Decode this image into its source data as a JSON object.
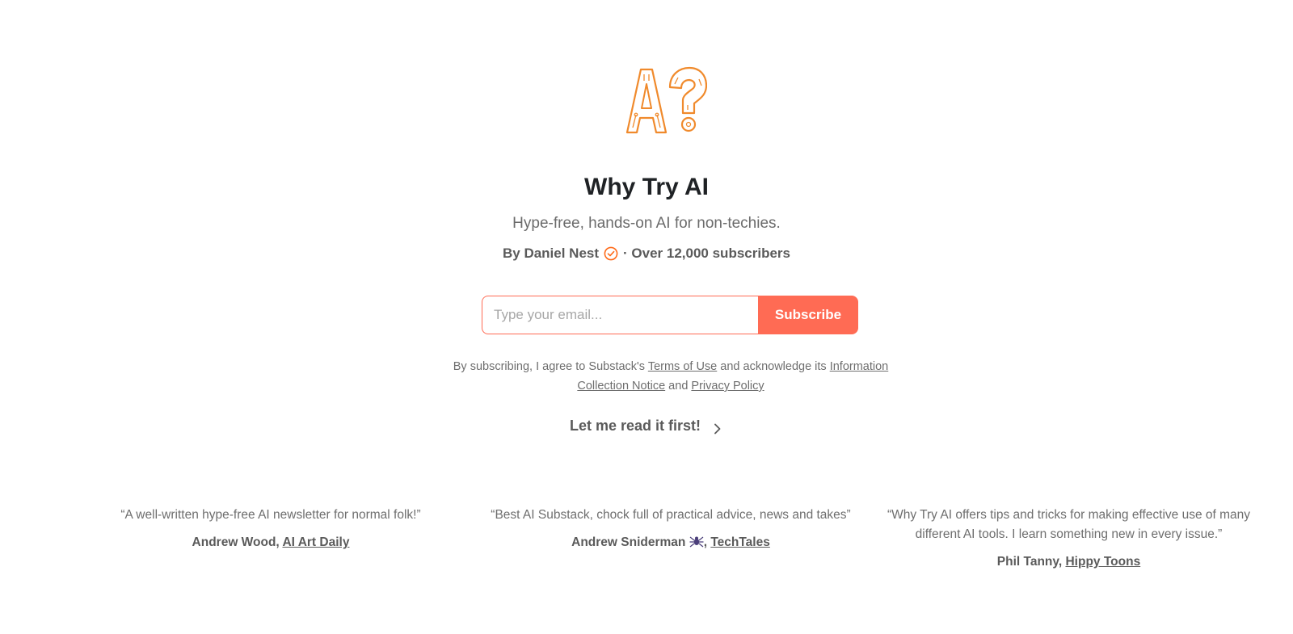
{
  "brand": {
    "logo_icon": "ai-question-mark-logo",
    "accent_color": "#ff6b54",
    "logo_color": "#f08a2c"
  },
  "header": {
    "title": "Why Try AI",
    "tagline": "Hype-free, hands-on AI for non-techies.",
    "byline_author": "By Daniel Nest",
    "byline_subscribers": "· Over 12,000 subscribers"
  },
  "subscribe": {
    "email_placeholder": "Type your email...",
    "button_label": "Subscribe"
  },
  "legal": {
    "text_1": "By subscribing, I agree to Substack's ",
    "terms_link": "Terms of Use",
    "text_2": " and acknowledge its ",
    "info_link": "Information Collection Notice",
    "text_3": " and ",
    "privacy_link": "Privacy Policy"
  },
  "read_first": {
    "label": "Let me read it first!"
  },
  "testimonials": [
    {
      "quote": "“A well-written hype-free AI newsletter for normal folk!”",
      "author": "Andrew Wood, ",
      "publication": "AI Art Daily"
    },
    {
      "quote": "“Best AI Substack, chock full of practical advice, news and takes”",
      "author": "Andrew Sniderman",
      "author_suffix": ", ",
      "publication": "TechTales"
    },
    {
      "quote": "“Why Try AI offers tips and tricks for making effective use of many different AI tools. I learn something new in every issue.”",
      "author": "Phil Tanny, ",
      "publication": "Hippy Toons"
    }
  ]
}
